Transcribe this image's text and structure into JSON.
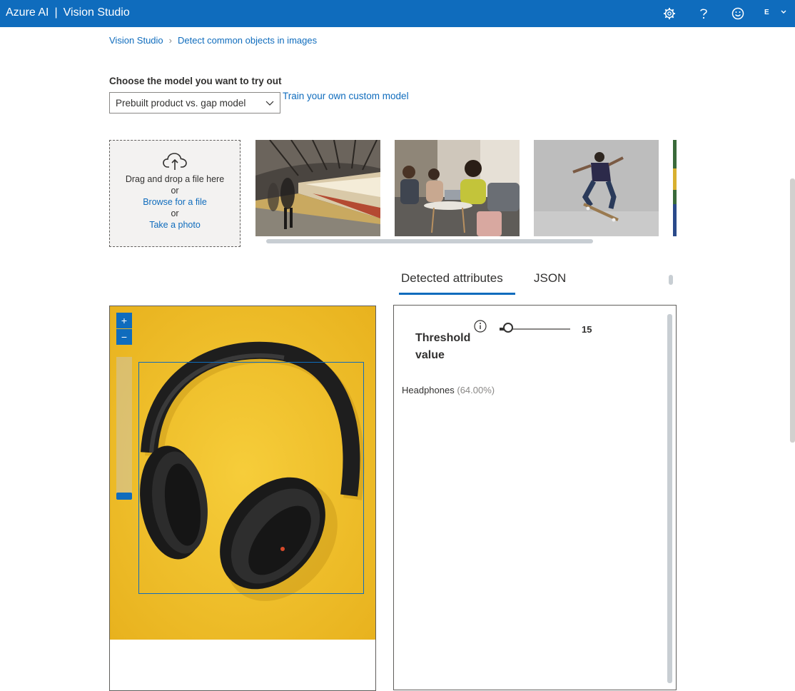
{
  "header": {
    "brand": "Azure AI",
    "separator": "|",
    "product": "Vision Studio",
    "user_initial": "E"
  },
  "breadcrumb": [
    "Vision Studio",
    "Detect common objects in images"
  ],
  "model": {
    "label": "Choose the model you want to try out",
    "selected": "Prebuilt product vs. gap model",
    "train_link": "Train your own custom model"
  },
  "upload": {
    "drag_text": "Drag and drop a file here",
    "or1": "or",
    "browse": "Browse for a file",
    "or2": "or",
    "photo": "Take a photo"
  },
  "tabs": {
    "detected": "Detected attributes",
    "json": "JSON"
  },
  "threshold": {
    "label_line1": "Threshold",
    "label_line2": "value",
    "value": "15"
  },
  "results": [
    {
      "name": "Headphones",
      "confidence": "(64.00%)"
    }
  ],
  "colors": {
    "accent": "#0f6cbd",
    "header_bg": "#0f6cbd",
    "image_bg": "#f2c12e"
  }
}
